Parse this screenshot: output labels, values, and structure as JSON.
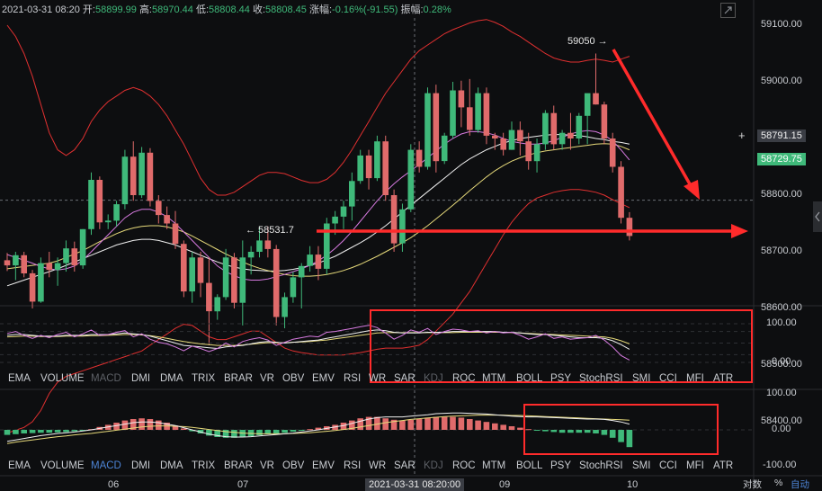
{
  "info": {
    "datetime": "2021-03-31 08:20",
    "open_label": "开:",
    "open": "58899.99",
    "high_label": "高:",
    "high": "58970.44",
    "low_label": "低:",
    "low": "58808.44",
    "close_label": "收:",
    "close": "58808.45",
    "change_label": "涨幅:",
    "change": "-0.16%(-91.55)",
    "amp_label": "振幅:",
    "amp": "0.28%"
  },
  "tabs": [
    "EMA",
    "VOLUME",
    "MACD",
    "DMI",
    "DMA",
    "TRIX",
    "BRAR",
    "VR",
    "OBV",
    "EMV",
    "RSI",
    "WR",
    "SAR",
    "KDJ",
    "ROC",
    "MTM",
    "BOLL",
    "PSY",
    "StochRSI",
    "SMI",
    "CCI",
    "MFI",
    "ATR"
  ],
  "tabs_mid_dim": [
    "MACD",
    "KDJ"
  ],
  "tabs_bot_dim": [
    "KDJ"
  ],
  "tabs_bot_active": "MACD",
  "price_axis": [
    "59100.00",
    "59000.00",
    "58900.00",
    "58800.00",
    "58700.00",
    "58600.00",
    "58500.00",
    "58400.00"
  ],
  "osc_axis": [
    "100.00",
    "0.00"
  ],
  "macd_axis": [
    "100.00",
    "0.00",
    "-100.00"
  ],
  "x_labels": [
    "06",
    "07",
    "09",
    "10"
  ],
  "crosshair_time": "2021-03-31 08:20:00",
  "crosshair_price": "58791.15",
  "last_price": "58729.75",
  "high_marker": "59050 →",
  "low_marker": "← 58531.7",
  "corner_labels": [
    "对数",
    "%",
    "自动"
  ],
  "colors": {
    "up": "#3fb97a",
    "down": "#e06b6b",
    "ma1": "#f0f0f0",
    "ma2": "#e6d97a",
    "ma3": "#d77ae0",
    "boll": "#e03030",
    "annot": "#ff2b2b"
  },
  "chart_data": {
    "type": "candlestick",
    "candles": [
      [
        58685,
        58698,
        58666,
        58676
      ],
      [
        58676,
        58700,
        58650,
        58694
      ],
      [
        58694,
        58700,
        58655,
        58662
      ],
      [
        58662,
        58668,
        58600,
        58612
      ],
      [
        58612,
        58690,
        58610,
        58680
      ],
      [
        58680,
        58700,
        58655,
        58668
      ],
      [
        58668,
        58690,
        58640,
        58680
      ],
      [
        58680,
        58720,
        58665,
        58706
      ],
      [
        58706,
        58718,
        58665,
        58676
      ],
      [
        58676,
        58740,
        58670,
        58740
      ],
      [
        58740,
        58840,
        58730,
        58827
      ],
      [
        58827,
        58833,
        58740,
        58752
      ],
      [
        58752,
        58766,
        58740,
        58755
      ],
      [
        58755,
        58790,
        58745,
        58784
      ],
      [
        58784,
        58880,
        58775,
        58868
      ],
      [
        58868,
        58895,
        58790,
        58800
      ],
      [
        58800,
        58885,
        58795,
        58875
      ],
      [
        58875,
        58883,
        58780,
        58790
      ],
      [
        58790,
        58800,
        58750,
        58765
      ],
      [
        58765,
        58780,
        58740,
        58750
      ],
      [
        58750,
        58772,
        58705,
        58714
      ],
      [
        58714,
        58720,
        58620,
        58630
      ],
      [
        58630,
        58700,
        58610,
        58690
      ],
      [
        58690,
        58700,
        58620,
        58645
      ],
      [
        58645,
        58690,
        58535,
        58595
      ],
      [
        58595,
        58625,
        58580,
        58620
      ],
      [
        58620,
        58705,
        58615,
        58690
      ],
      [
        58690,
        58698,
        58600,
        58610
      ],
      [
        58610,
        58720,
        58570,
        58690
      ],
      [
        58690,
        58710,
        58660,
        58700
      ],
      [
        58700,
        58745,
        58690,
        58720
      ],
      [
        58720,
        58745,
        58690,
        58705
      ],
      [
        58705,
        58712,
        58570,
        58585
      ],
      [
        58585,
        58628,
        58565,
        58620
      ],
      [
        58620,
        58665,
        58610,
        58655
      ],
      [
        58655,
        58680,
        58600,
        58675
      ],
      [
        58675,
        58710,
        58665,
        58695
      ],
      [
        58695,
        58710,
        58650,
        58670
      ],
      [
        58670,
        58760,
        58660,
        58750
      ],
      [
        58750,
        58772,
        58730,
        58762
      ],
      [
        58762,
        58790,
        58740,
        58780
      ],
      [
        58780,
        58840,
        58755,
        58825
      ],
      [
        58825,
        58880,
        58820,
        58870
      ],
      [
        58870,
        58880,
        58810,
        58830
      ],
      [
        58830,
        58905,
        58825,
        58895
      ],
      [
        58895,
        58905,
        58790,
        58800
      ],
      [
        58800,
        58810,
        58700,
        58715
      ],
      [
        58715,
        58785,
        58700,
        58775
      ],
      [
        58775,
        58890,
        58770,
        58880
      ],
      [
        58880,
        58895,
        58840,
        58850
      ],
      [
        58850,
        58990,
        58845,
        58980
      ],
      [
        58980,
        58995,
        58840,
        58860
      ],
      [
        58860,
        58910,
        58855,
        58905
      ],
      [
        58905,
        59000,
        58900,
        58985
      ],
      [
        58985,
        59002,
        58920,
        58955
      ],
      [
        58955,
        59005,
        58905,
        58915
      ],
      [
        58915,
        58990,
        58910,
        58980
      ],
      [
        58980,
        58990,
        58890,
        58905
      ],
      [
        58905,
        58910,
        58880,
        58900
      ],
      [
        58900,
        58910,
        58870,
        58880
      ],
      [
        58880,
        58930,
        58880,
        58915
      ],
      [
        58915,
        58930,
        58870,
        58895
      ],
      [
        58895,
        58910,
        58845,
        58860
      ],
      [
        58860,
        58900,
        58840,
        58890
      ],
      [
        58890,
        58950,
        58880,
        58945
      ],
      [
        58945,
        58958,
        58880,
        58890
      ],
      [
        58890,
        58915,
        58880,
        58910
      ],
      [
        58910,
        58945,
        58880,
        58900
      ],
      [
        58900,
        58945,
        58890,
        58940
      ],
      [
        58940,
        58975,
        58890,
        58980
      ],
      [
        58980,
        59050,
        58960,
        58960
      ],
      [
        58960,
        58965,
        58890,
        58900
      ],
      [
        58900,
        58910,
        58840,
        58850
      ],
      [
        58850,
        58860,
        58750,
        58760
      ],
      [
        58760,
        58770,
        58720,
        58728
      ]
    ],
    "ma1": [
      58690,
      58688,
      58685,
      58680,
      58678,
      58676,
      58675,
      58676,
      58678,
      58682,
      58690,
      58700,
      58708,
      58716,
      58726,
      58736,
      58744,
      58750,
      58752,
      58752,
      58750,
      58745,
      58738,
      58730,
      58722,
      58712,
      58702,
      58694,
      58686,
      58680,
      58676,
      58672,
      58668,
      58666,
      58666,
      58668,
      58670,
      58672,
      58676,
      58680,
      58686,
      58694,
      58704,
      58714,
      58725,
      58736,
      58746,
      58756,
      58768,
      58780,
      58792,
      58806,
      58820,
      58835,
      58850,
      58862,
      58872,
      58880,
      58886,
      58890,
      58893,
      58895,
      58896,
      58896,
      58895,
      58894,
      58893,
      58893,
      58894,
      58896,
      58900,
      58902,
      58902,
      58898,
      58890
    ],
    "ma2": [
      58670,
      58672,
      58674,
      58676,
      58678,
      58680,
      58684,
      58690,
      58696,
      58702,
      58710,
      58718,
      58725,
      58732,
      58738,
      58742,
      58745,
      58746,
      58746,
      58744,
      58740,
      58735,
      58728,
      58720,
      58712,
      58704,
      58696,
      58689,
      58682,
      58676,
      58671,
      58667,
      58663,
      58660,
      58658,
      58657,
      58657,
      58658,
      58660,
      58663,
      58667,
      58672,
      58678,
      58685,
      58692,
      58700,
      58708,
      58716,
      58725,
      58735,
      58746,
      58758,
      58770,
      58782,
      58795,
      58808,
      58820,
      58832,
      58843,
      58852,
      58860,
      58866,
      58871,
      58875,
      58878,
      58880,
      58882,
      58884,
      58886,
      58888,
      58890,
      58891,
      58890,
      58886,
      58880
    ],
    "ma3": [
      58695,
      58690,
      58685,
      58680,
      58674,
      58670,
      58668,
      58670,
      58675,
      58685,
      58700,
      58715,
      58730,
      58745,
      58760,
      58770,
      58775,
      58775,
      58770,
      58762,
      58750,
      58735,
      58720,
      58705,
      58690,
      58675,
      58665,
      58658,
      58652,
      58650,
      58650,
      58652,
      58656,
      58660,
      58665,
      58670,
      58676,
      58684,
      58694,
      58706,
      58720,
      58736,
      58754,
      58772,
      58790,
      58806,
      58820,
      58832,
      58843,
      58854,
      58866,
      58878,
      58890,
      58900,
      58908,
      58912,
      58912,
      58910,
      58906,
      58900,
      58895,
      58892,
      58890,
      58890,
      58892,
      58896,
      58902,
      58908,
      58912,
      58914,
      58912,
      58906,
      58896,
      58880,
      58862
    ],
    "boll_upper": [
      59100,
      59080,
      59050,
      59010,
      58960,
      58910,
      58880,
      58870,
      58880,
      58900,
      58930,
      58950,
      58965,
      58975,
      58985,
      58990,
      58985,
      58975,
      58960,
      58940,
      58915,
      58890,
      58860,
      58830,
      58810,
      58800,
      58800,
      58805,
      58815,
      58825,
      58835,
      58840,
      58840,
      58838,
      58832,
      58826,
      58822,
      58822,
      58828,
      58840,
      58858,
      58880,
      58905,
      58930,
      58955,
      58980,
      59000,
      59020,
      59040,
      59055,
      59065,
      59075,
      59085,
      59092,
      59098,
      59104,
      59108,
      59110,
      59105,
      59098,
      59088,
      59080,
      59070,
      59060,
      59050,
      59042,
      59038,
      59035,
      59035,
      59038,
      59040,
      59038,
      59035,
      59040,
      59045
    ],
    "boll_lower": [
      58380,
      58385,
      58390,
      58400,
      58420,
      58450,
      58470,
      58480,
      58485,
      58490,
      58495,
      58500,
      58505,
      58510,
      58515,
      58520,
      58525,
      58535,
      58545,
      58555,
      58565,
      58572,
      58570,
      58560,
      58550,
      58545,
      58545,
      58550,
      58555,
      58560,
      58560,
      58550,
      58540,
      58530,
      58525,
      58522,
      58520,
      58518,
      58518,
      58518,
      58518,
      58520,
      58522,
      58525,
      58528,
      58530,
      58530,
      58530,
      58532,
      58535,
      58545,
      58560,
      58575,
      58590,
      58610,
      58630,
      58655,
      58680,
      58705,
      58730,
      58752,
      58770,
      58785,
      58795,
      58800,
      58805,
      58808,
      58810,
      58810,
      58808,
      58805,
      58800,
      58792,
      58785,
      58778
    ],
    "mid_ma": [
      58640,
      58645,
      58650,
      58655,
      58660,
      58665,
      58670,
      58676,
      58682,
      58688,
      58694,
      58700,
      58706,
      58712,
      58716,
      58720,
      58722,
      58722,
      58720,
      58716,
      58712,
      58706,
      58700,
      58694,
      58688,
      58682,
      58677,
      58673,
      58670,
      58668,
      58667,
      58666,
      58666,
      58667,
      58669,
      58672,
      58676,
      58680,
      58686,
      58692,
      58700,
      58708,
      58716,
      58725,
      58735,
      58746,
      58758,
      58770,
      58782,
      58794,
      58806,
      58818,
      58830,
      58842,
      58854,
      58864,
      58872,
      58880,
      58886,
      58892,
      58896,
      58900,
      58902,
      58904,
      58906,
      58907,
      58907,
      58906,
      58905,
      58903,
      58900,
      58898,
      58895,
      58893,
      58890
    ],
    "osc_k": [
      75,
      80,
      70,
      62,
      70,
      64,
      72,
      78,
      66,
      74,
      84,
      70,
      72,
      78,
      82,
      66,
      74,
      60,
      52,
      48,
      40,
      30,
      42,
      36,
      28,
      36,
      50,
      40,
      54,
      60,
      64,
      58,
      44,
      52,
      60,
      64,
      68,
      66,
      78,
      80,
      84,
      88,
      92,
      96,
      90,
      76,
      60,
      70,
      84,
      78,
      88,
      72,
      80,
      86,
      84,
      80,
      82,
      76,
      80,
      76,
      78,
      70,
      60,
      66,
      74,
      62,
      66,
      60,
      62,
      64,
      70,
      58,
      40,
      18,
      6
    ],
    "osc_d": [
      70,
      72,
      72,
      70,
      68,
      68,
      68,
      70,
      70,
      70,
      72,
      72,
      72,
      74,
      76,
      74,
      72,
      68,
      62,
      56,
      50,
      44,
      42,
      40,
      38,
      36,
      40,
      42,
      44,
      48,
      52,
      54,
      52,
      50,
      52,
      54,
      56,
      58,
      62,
      66,
      70,
      74,
      78,
      82,
      84,
      82,
      78,
      76,
      76,
      76,
      78,
      78,
      78,
      80,
      80,
      80,
      80,
      80,
      80,
      78,
      78,
      76,
      74,
      72,
      72,
      70,
      68,
      66,
      64,
      64,
      64,
      62,
      56,
      46,
      34
    ],
    "osc_e": [
      66,
      67,
      68,
      68,
      67,
      67,
      67,
      68,
      68,
      68,
      69,
      69,
      70,
      71,
      72,
      72,
      71,
      69,
      66,
      62,
      58,
      54,
      51,
      48,
      46,
      44,
      44,
      44,
      45,
      47,
      49,
      51,
      51,
      51,
      52,
      53,
      54,
      56,
      58,
      61,
      64,
      67,
      70,
      73,
      76,
      77,
      77,
      77,
      77,
      77,
      77,
      77,
      77,
      77,
      78,
      78,
      78,
      78,
      78,
      78,
      77,
      76,
      75,
      74,
      73,
      72,
      71,
      70,
      69,
      68,
      67,
      66,
      62,
      56,
      48
    ],
    "macd_hist": [
      -14,
      -12,
      -10,
      -9,
      -8,
      -8,
      -7,
      -6,
      -4,
      -2,
      2,
      8,
      14,
      20,
      26,
      30,
      32,
      30,
      26,
      20,
      12,
      4,
      -4,
      -10,
      -16,
      -20,
      -22,
      -22,
      -20,
      -18,
      -15,
      -12,
      -10,
      -8,
      -5,
      -2,
      2,
      6,
      10,
      14,
      20,
      26,
      32,
      36,
      36,
      32,
      28,
      26,
      28,
      30,
      34,
      36,
      36,
      36,
      34,
      30,
      26,
      22,
      18,
      14,
      10,
      6,
      2,
      -2,
      -4,
      -6,
      -8,
      -8,
      -8,
      -8,
      -10,
      -14,
      -22,
      -34,
      -48
    ],
    "macd_dif": [
      -32,
      -28,
      -24,
      -20,
      -16,
      -13,
      -10,
      -8,
      -6,
      -3,
      0,
      4,
      8,
      12,
      16,
      20,
      22,
      22,
      20,
      16,
      12,
      6,
      0,
      -6,
      -12,
      -16,
      -19,
      -20,
      -20,
      -19,
      -17,
      -15,
      -13,
      -11,
      -9,
      -6,
      -3,
      0,
      4,
      8,
      12,
      18,
      24,
      30,
      34,
      36,
      36,
      36,
      38,
      40,
      42,
      45,
      46,
      47,
      47,
      46,
      45,
      44,
      42,
      40,
      38,
      37,
      36,
      36,
      35,
      34,
      33,
      32,
      31,
      30,
      30,
      29,
      26,
      22,
      16
    ],
    "macd_dea": [
      -38,
      -34,
      -31,
      -28,
      -25,
      -22,
      -19,
      -17,
      -14,
      -12,
      -10,
      -7,
      -4,
      -1,
      2,
      5,
      8,
      10,
      11,
      11,
      10,
      9,
      7,
      4,
      1,
      -2,
      -5,
      -7,
      -9,
      -10,
      -11,
      -11,
      -11,
      -11,
      -10,
      -9,
      -8,
      -6,
      -4,
      -2,
      1,
      4,
      8,
      12,
      16,
      20,
      23,
      26,
      29,
      31,
      33,
      35,
      37,
      38,
      39,
      40,
      41,
      41,
      41,
      41,
      40,
      40,
      39,
      38,
      37,
      36,
      35,
      34,
      33,
      32,
      31,
      30,
      29,
      28,
      27
    ]
  }
}
